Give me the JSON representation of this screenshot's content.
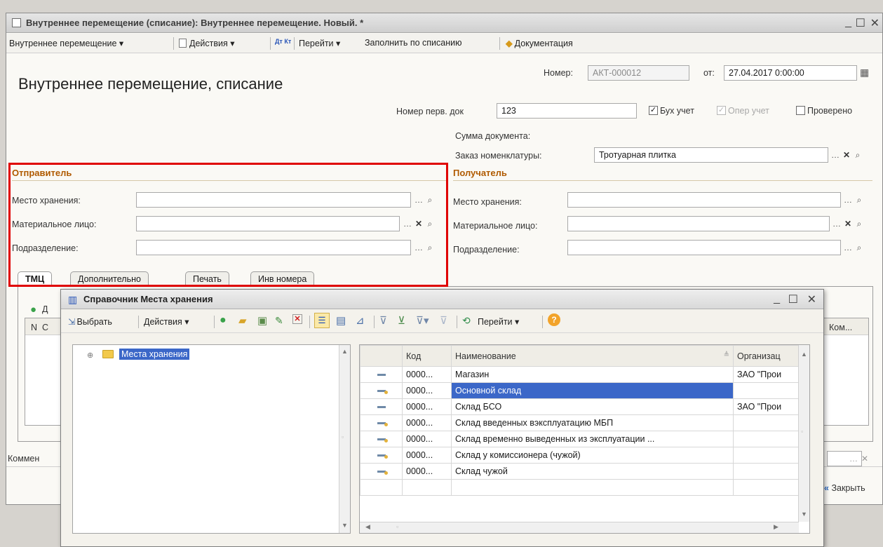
{
  "main_window": {
    "title": "Внутреннее перемещение (списание): Внутреннее перемещение. Новый. *",
    "toolbar": {
      "doc_menu": "Внутреннее перемещение ▾",
      "actions": "Действия ▾",
      "dt_kt": "Дт Кт",
      "goto": "Перейти ▾",
      "fill": "Заполнить по списанию",
      "docs": "Документация"
    },
    "heading": "Внутреннее перемещение, списание",
    "number_label": "Номер:",
    "number_value": "АКТ-000012",
    "date_label": "от:",
    "date_value": "27.04.2017 0:00:00",
    "primary_doc_label": "Номер перв. док",
    "primary_doc_value": "123",
    "buh_label": "Бух учет",
    "oper_label": "Опер учет",
    "checked_label": "Проверено",
    "sum_label": "Сумма документа:",
    "order_label": "Заказ номенклатуры:",
    "order_value": "Тротуарная плитка",
    "sender": {
      "title": "Отправитель",
      "storage_label": "Место хранения:",
      "person_label": "Материальное лицо:",
      "dept_label": "Подразделение:"
    },
    "receiver": {
      "title": "Получатель",
      "storage_label": "Место хранения:",
      "person_label": "Материальное лицо:",
      "dept_label": "Подразделение:"
    },
    "tabs": [
      "ТМЦ",
      "Дополнительно",
      "Печать",
      "Инв номера"
    ],
    "add_label": "Д",
    "col_n": "N",
    "col_c": "С",
    "col_kom": "Ком...",
    "comment_label": "Коммен",
    "close_label": "Закрыть"
  },
  "dialog": {
    "title": "Справочник Места хранения",
    "toolbar": {
      "select": "Выбрать",
      "actions": "Действия ▾",
      "goto": "Перейти ▾"
    },
    "tree_root": "Места хранения",
    "columns": [
      "Код",
      "Наименование",
      "Организац"
    ],
    "rows": [
      {
        "icon": "a",
        "code": "0000...",
        "name": "Магазин",
        "org": "ЗАО \"Прои"
      },
      {
        "icon": "b",
        "code": "0000...",
        "name": "Основной склад",
        "org": ""
      },
      {
        "icon": "a",
        "code": "0000...",
        "name": "Склад БСО",
        "org": "ЗАО \"Прои"
      },
      {
        "icon": "b",
        "code": "0000...",
        "name": "Склад введенных вэксплуатацию МБП",
        "org": ""
      },
      {
        "icon": "b",
        "code": "0000...",
        "name": "Склад временно выведенных из эксплуатации ...",
        "org": ""
      },
      {
        "icon": "b",
        "code": "0000...",
        "name": "Склад у комиссионера (чужой)",
        "org": ""
      },
      {
        "icon": "b",
        "code": "0000...",
        "name": "Склад чужой",
        "org": ""
      }
    ]
  }
}
